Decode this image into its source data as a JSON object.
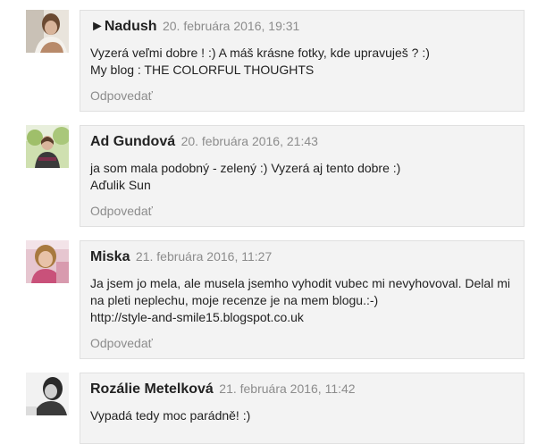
{
  "comments": [
    {
      "author": "►Nadush",
      "date": "20. februára 2016, 19:31",
      "lines": [
        "Vyzerá veľmi dobre ! :) A máš krásne fotky, kde upravuješ ? :)",
        "My blog : THE COLORFUL THOUGHTS"
      ],
      "reply": "Odpovedať",
      "avatar_icon": "user-photo"
    },
    {
      "author": "Ad Gundová",
      "date": "20. februára 2016, 21:43",
      "lines": [
        "ja som mala podobný - zelený :) Vyzerá aj tento dobre :)",
        "Aďulik Sun"
      ],
      "reply": "Odpovedať",
      "avatar_icon": "user-photo"
    },
    {
      "author": "Miska",
      "date": "21. februára 2016, 11:27",
      "lines": [
        "Ja jsem jo mela, ale musela jsemho vyhodit vubec mi nevyhovoval. Delal mi",
        "na pleti neplechu, moje recenze je na mem blogu.:-)",
        "http://style-and-smile15.blogspot.co.uk"
      ],
      "reply": "Odpovedať",
      "avatar_icon": "user-photo"
    },
    {
      "author": "Rozálie Metelková",
      "date": "21. februára 2016, 11:42",
      "lines": [
        "Vypadá tedy moc parádně! :)"
      ],
      "reply": "",
      "avatar_icon": "user-photo"
    }
  ]
}
